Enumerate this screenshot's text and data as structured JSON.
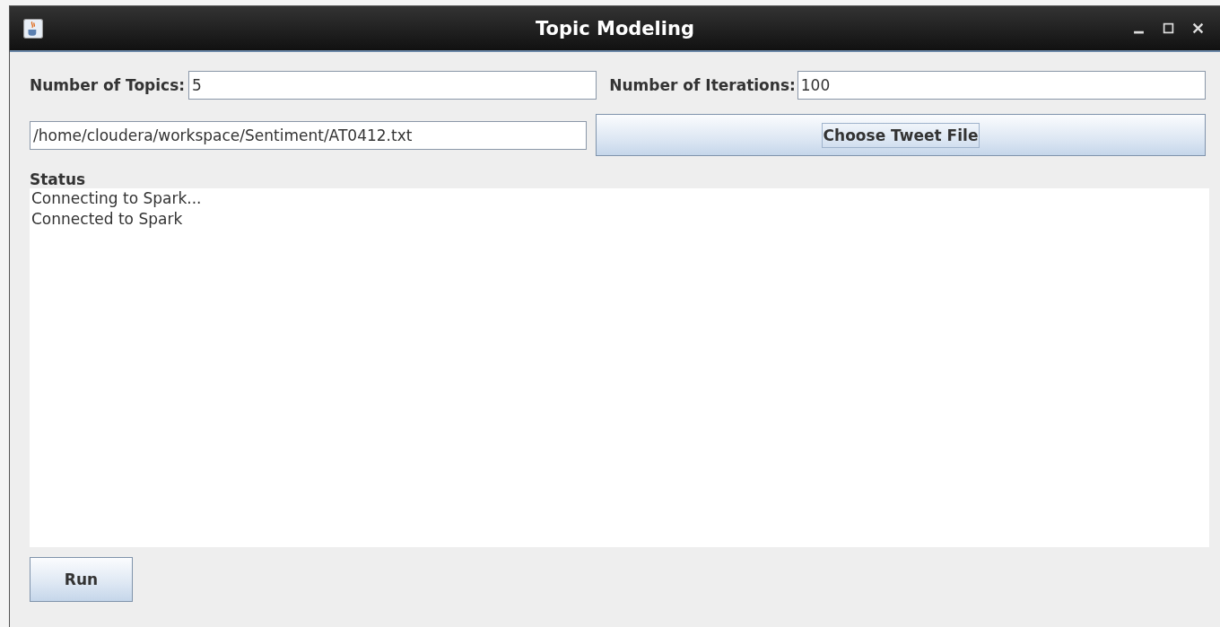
{
  "window": {
    "title": "Topic Modeling"
  },
  "topics": {
    "label": "Number of Topics:",
    "value": "5"
  },
  "iterations": {
    "label": "Number of Iterations:",
    "value": "100"
  },
  "file": {
    "value": "/home/cloudera/workspace/Sentiment/AT0412.txt"
  },
  "choose_button": {
    "label": "Choose Tweet File",
    "focused": true
  },
  "status": {
    "label": "Status",
    "lines": [
      "Connecting to Spark...",
      "Connected to Spark"
    ]
  },
  "run_button": {
    "label": "Run",
    "focused": false
  }
}
